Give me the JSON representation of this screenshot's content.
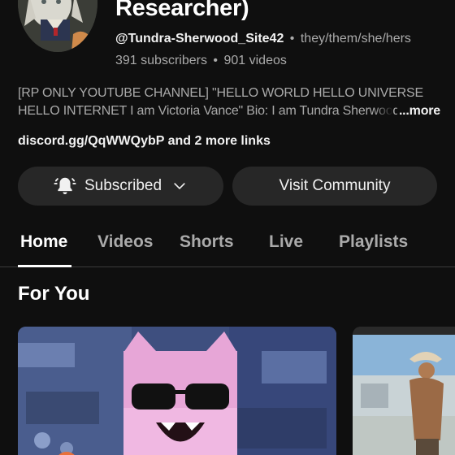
{
  "channel": {
    "name_tail": "Researcher)",
    "handle": "@Tundra-Sherwood_Site42",
    "pronouns": "they/them/she/hers",
    "subscribers": "391 subscribers",
    "videos": "901 videos",
    "separator": "•",
    "description_line1": "[RP ONLY YOUTUBE CHANNEL] \"HELLO WORLD HELLO UNIVERSE",
    "description_line2": "HELLO INTERNET I am Victoria Vance\" Bio: I am Tundra Sherwood",
    "more_label": "...more",
    "link_text": "discord.gg/QqWWQybP",
    "more_links": "and 2 more links"
  },
  "actions": {
    "subscribed_label": "Subscribed",
    "community_label": "Visit Community"
  },
  "tabs": [
    {
      "label": "Home",
      "active": true
    },
    {
      "label": "Videos"
    },
    {
      "label": "Shorts"
    },
    {
      "label": "Live"
    },
    {
      "label": "Playlists"
    }
  ],
  "section": {
    "title": "For You"
  },
  "icons": {
    "bell": "notifications-active-icon",
    "chevron": "chevron-down-icon"
  },
  "colors": {
    "background": "#0f0f0f",
    "button": "#272727",
    "text_primary": "#f1f1f1",
    "text_secondary": "#aaaaaa"
  }
}
